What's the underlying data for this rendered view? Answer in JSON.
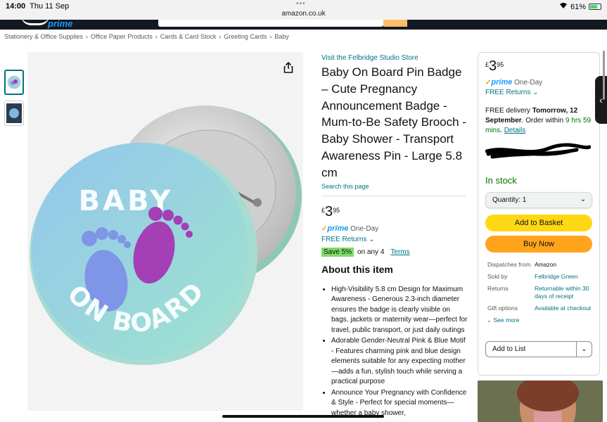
{
  "status_bar": {
    "time": "14:00",
    "date": "Thu 11 Sep",
    "url": "amazon.co.uk",
    "battery": "61%"
  },
  "header": {
    "prime_label": "prime"
  },
  "breadcrumb": [
    "Stationery & Office Supplies",
    "Office Paper Products",
    "Cards & Card Stock",
    "Greeting Cards",
    "Baby"
  ],
  "product": {
    "store_link": "Visit the Felbridge Studio Store",
    "title": "Baby On Board Pin Badge – Cute Pregnancy Announcement Badge - Mum-to-Be Safety Brooch - Baby Shower - Transport Awareness Pin - Large 5.8 cm",
    "search_page": "Search this page",
    "price_currency": "£",
    "price_whole": "3",
    "price_fraction": "95",
    "prime_label": "prime",
    "prime_speed": "One-Day",
    "free_returns": "FREE Returns",
    "save_badge": "Save 5%",
    "save_text": "on any 4",
    "terms_label": "Terms",
    "about_heading": "About this item",
    "bullets": [
      "High-Visibility 5.8 cm Design for Maximum Awareness - Generous 2.3-inch diameter ensures the badge is clearly visible on bags, jackets or maternity wear—perfect for travel, public transport, or just daily outings",
      "Adorable Gender-Neutral Pink & Blue Motif - Features charming pink and blue design elements suitable for any expecting mother—adds a fun, stylish touch while serving a practical purpose",
      "Announce Your Pregnancy with Confidence & Style - Perfect for special moments—whether a baby shower,"
    ],
    "image_text_top": "BABY",
    "image_text_bottom": "ON BOARD"
  },
  "buybox": {
    "price_currency": "£",
    "price_whole": "3",
    "price_fraction": "95",
    "prime_label": "prime",
    "prime_speed": "One-Day",
    "free_returns": "FREE Returns",
    "delivery_prefix": "FREE delivery",
    "delivery_date": "Tomorrow, 12 September",
    "delivery_mid": ". Order within",
    "delivery_time": "9 hrs 59 mins",
    "details_link": "Details",
    "stock": "In stock",
    "quantity": "Quantity: 1",
    "add_to_basket": "Add to Basket",
    "buy_now": "Buy Now",
    "info": [
      {
        "key": "Dispatches from",
        "value": "Amazon"
      },
      {
        "key": "Sold by",
        "value": "Felbridge Green"
      },
      {
        "key": "Returns",
        "value": "Returnable within 30 days of receipt"
      },
      {
        "key": "Gift options",
        "value": "Available at checkout"
      }
    ],
    "see_more": "See more",
    "add_to_list": "Add to List"
  },
  "colors": {
    "accent_link": "#007185",
    "basket_yellow": "#ffd814",
    "buy_orange": "#ffa41c",
    "in_stock_green": "#007600"
  }
}
